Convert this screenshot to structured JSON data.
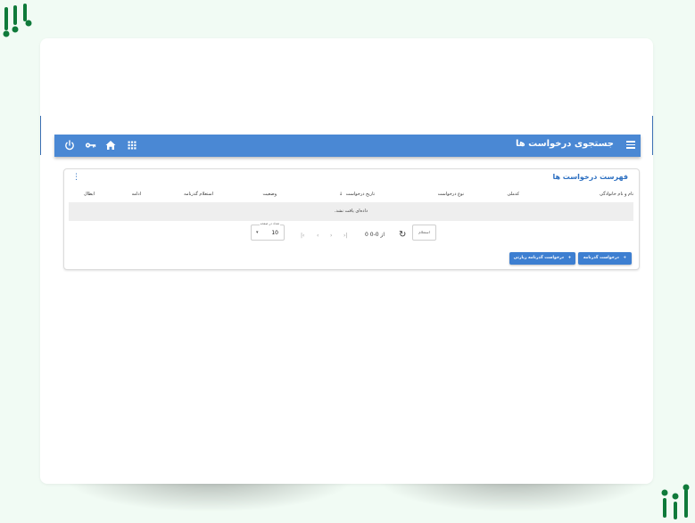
{
  "app": {
    "title": "جستجوی درخواست ها"
  },
  "appbar_icons": [
    "menu-icon",
    "power-icon",
    "key-icon",
    "home-icon",
    "apps-grid-icon"
  ],
  "panel": {
    "title": "فهرست درخواست ها",
    "columns": [
      "نام و نام خانوادگی",
      "کدملی",
      "نوع درخواست",
      "تاریخ درخواست",
      "وضعیت",
      "استعلام گذرنامه",
      "ادامه",
      "ابطال"
    ],
    "sort_indicator": "↓",
    "empty_message": "داده‌ای یافت نشد.",
    "per_page_label": "تعداد در صفحه",
    "per_page_value": "10",
    "pager_info": "0 از 0-0",
    "inquiry_button": "استعلام",
    "buttons": {
      "passport_request": "درخواست گذرنامه",
      "pilgrimage_passport_request": "درخواست گذرنامه زیارتی"
    }
  },
  "colors": {
    "appbar": "#4a88d4",
    "accent": "#2c6fc1",
    "button": "#3d7fd1",
    "logo": "#0f7a3a"
  }
}
